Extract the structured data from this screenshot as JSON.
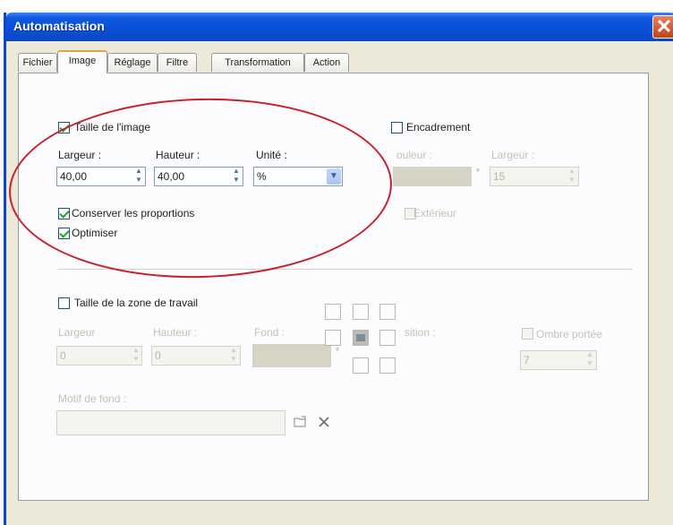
{
  "window": {
    "title": "Automatisation",
    "close_glyph": "✕"
  },
  "tabs": [
    {
      "label": "Fichier"
    },
    {
      "label": "Image"
    },
    {
      "label": "Réglage"
    },
    {
      "label": "Filtre"
    },
    {
      "label": "Transformation"
    },
    {
      "label": "Action"
    }
  ],
  "active_tab": "Image",
  "image_size": {
    "checkbox_label": "Taille de l'image",
    "checked": true,
    "width_label": "Largeur :",
    "width_value": "40,00",
    "height_label": "Hauteur :",
    "height_value": "40,00",
    "unit_label": "Unité :",
    "unit_value": "%",
    "keep_proportions_label": "Conserver les proportions",
    "keep_proportions_checked": true,
    "optimize_label": "Optimiser",
    "optimize_checked": true
  },
  "frame": {
    "checkbox_label": "Encadrement",
    "checked": false,
    "color_label": "ouleur :",
    "width_label": "Largeur :",
    "width_value": "15",
    "exterior_label": "Extérieur"
  },
  "workspace": {
    "checkbox_label": "Taille de la zone de travail",
    "checked": false,
    "width_label": "Largeur",
    "width_value": "0",
    "height_label": "Hauteur :",
    "height_value": "0",
    "background_label": "Fond :",
    "position_label": "sition :",
    "drop_shadow_label": "Ombre portée",
    "drop_shadow_value": "7",
    "background_pattern_label": "Motif de fond :",
    "background_pattern_value": ""
  },
  "icons": {
    "spin": "spin-arrows-icon",
    "dropdown": "chevron-down-icon",
    "browse": "folder-open-icon",
    "clear": "close-icon",
    "anchor": "image-anchor-icon"
  },
  "colors": {
    "titlebar": "#0a4fd6",
    "highlight_ellipse": "#c8202a",
    "check": "#21a121",
    "active_tab_top": "#e8a13a"
  }
}
